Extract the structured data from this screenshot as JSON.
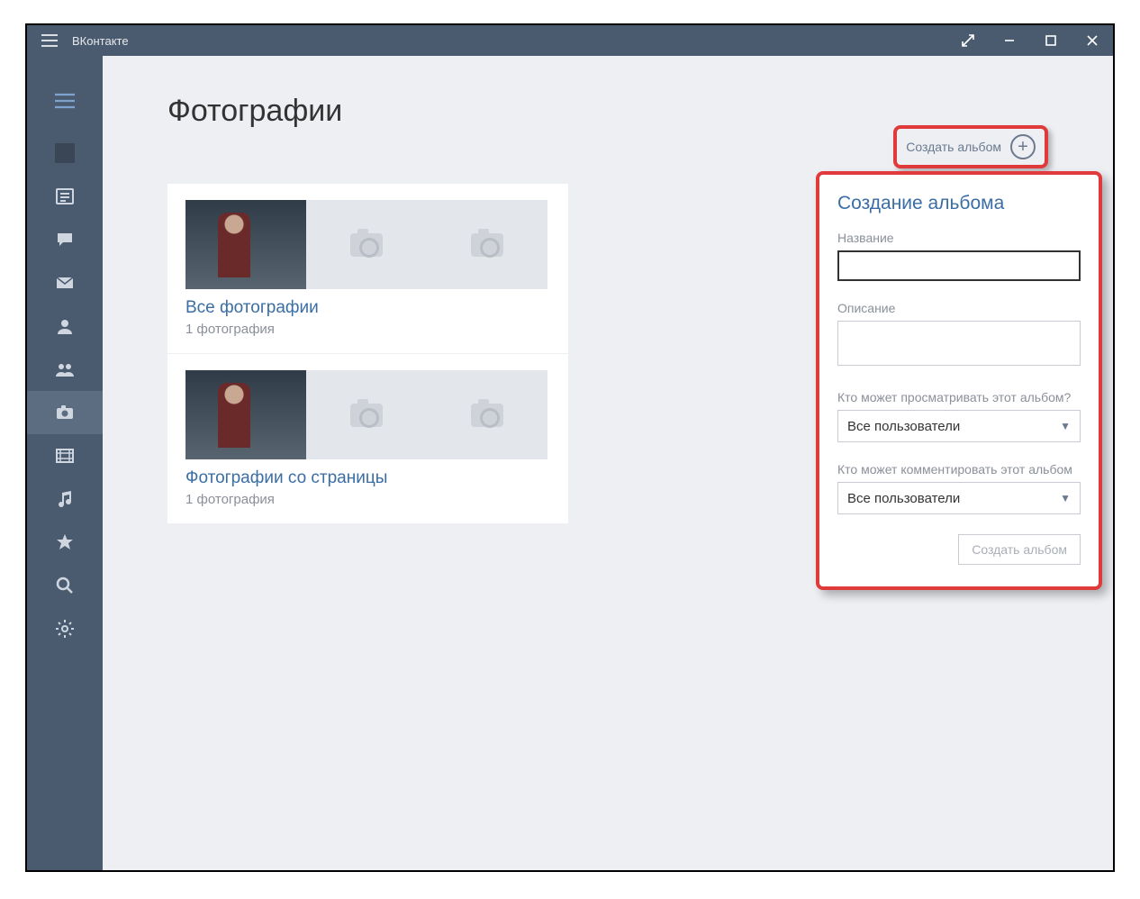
{
  "app": {
    "title": "ВКонтакте"
  },
  "page": {
    "title": "Фотографии"
  },
  "create_button": {
    "label": "Создать альбом"
  },
  "albums": [
    {
      "title": "Все фотографии",
      "count": "1 фотография"
    },
    {
      "title": "Фотографии со страницы",
      "count": "1 фотография"
    }
  ],
  "panel": {
    "heading": "Создание альбома",
    "name_label": "Название",
    "name_value": "",
    "desc_label": "Описание",
    "desc_value": "",
    "view_label": "Кто может просматривать этот альбом?",
    "view_value": "Все пользователи",
    "comment_label": "Кто может комментировать этот альбом",
    "comment_value": "Все пользователи",
    "submit_label": "Создать альбом"
  }
}
